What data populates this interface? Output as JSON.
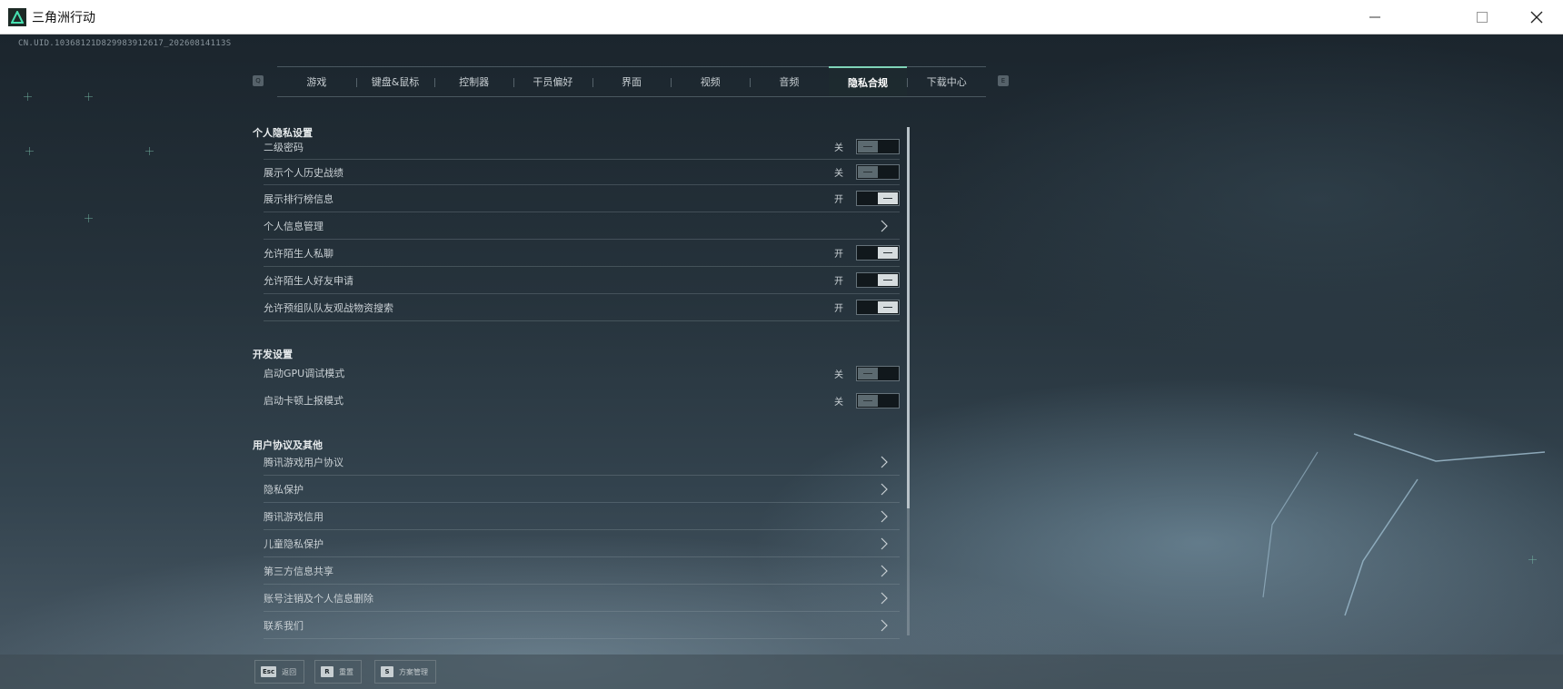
{
  "window": {
    "title": "三角洲行动",
    "controls": [
      "minimize",
      "maximize",
      "close"
    ]
  },
  "uid": "CN.UID.10368121D829983912617_20260814113S",
  "tabs": {
    "prev_key": "Q",
    "next_key": "E",
    "items": [
      {
        "label": "游戏",
        "active": false
      },
      {
        "label": "键盘&鼠标",
        "active": false
      },
      {
        "label": "控制器",
        "active": false
      },
      {
        "label": "干员偏好",
        "active": false
      },
      {
        "label": "界面",
        "active": false
      },
      {
        "label": "视频",
        "active": false
      },
      {
        "label": "音频",
        "active": false
      },
      {
        "label": "隐私合规",
        "active": true
      },
      {
        "label": "下载中心",
        "active": false
      }
    ]
  },
  "sections": {
    "personal": {
      "title": "个人隐私设置",
      "rows": [
        {
          "label": "二级密码",
          "type": "toggle",
          "state": "关",
          "on": false
        },
        {
          "label": "展示个人历史战绩",
          "type": "toggle",
          "state": "关",
          "on": false
        },
        {
          "label": "展示排行榜信息",
          "type": "toggle",
          "state": "开",
          "on": true
        },
        {
          "label": "个人信息管理",
          "type": "link"
        },
        {
          "label": "允许陌生人私聊",
          "type": "toggle",
          "state": "开",
          "on": true
        },
        {
          "label": "允许陌生人好友申请",
          "type": "toggle",
          "state": "开",
          "on": true
        },
        {
          "label": "允许预组队队友观战物资搜索",
          "type": "toggle",
          "state": "开",
          "on": true
        }
      ]
    },
    "dev": {
      "title": "开发设置",
      "rows": [
        {
          "label": "启动GPU调试模式",
          "type": "toggle",
          "state": "关",
          "on": false
        },
        {
          "label": "启动卡顿上报模式",
          "type": "toggle",
          "state": "关",
          "on": false
        }
      ]
    },
    "agreements": {
      "title": "用户协议及其他",
      "rows": [
        {
          "label": "腾讯游戏用户协议",
          "type": "link"
        },
        {
          "label": "隐私保护",
          "type": "link"
        },
        {
          "label": "腾讯游戏信用",
          "type": "link"
        },
        {
          "label": "儿童隐私保护",
          "type": "link"
        },
        {
          "label": "第三方信息共享",
          "type": "link"
        },
        {
          "label": "账号注销及个人信息删除",
          "type": "link"
        },
        {
          "label": "联系我们",
          "type": "link"
        }
      ]
    }
  },
  "bottom": {
    "items": [
      {
        "key": "Esc",
        "label": "返回"
      },
      {
        "key": "R",
        "label": "重置"
      },
      {
        "key": "S",
        "label": "方案管理"
      }
    ]
  },
  "colors": {
    "accent": "#7fd4b8",
    "toggle_on": "#d6dcde",
    "toggle_off": "#5c6a70"
  }
}
